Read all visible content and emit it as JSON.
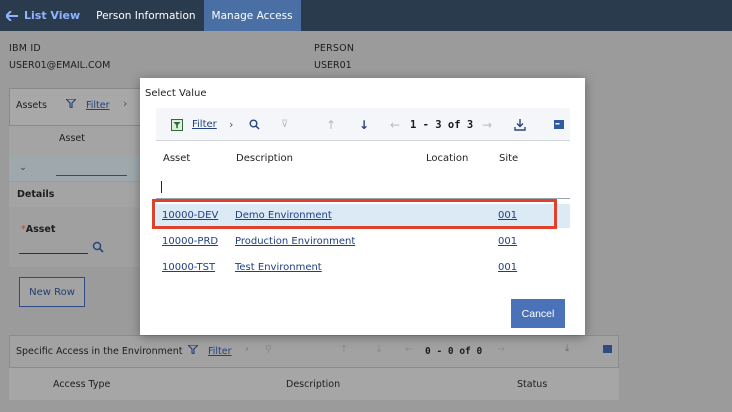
{
  "topbar": {
    "back_label": "List View",
    "tabs": [
      "Person Information",
      "Manage Access"
    ]
  },
  "person": {
    "ibm_id_label": "IBM ID",
    "ibm_id_value": "USER01@EMAIL.COM",
    "person_label": "PERSON",
    "person_value": "USER01"
  },
  "assets_section": {
    "tab_label": "Assets",
    "filter_label": "Filter",
    "column_asset": "Asset",
    "details_label": "Details",
    "asset_field_label": "Asset",
    "required_marker": "*",
    "new_row_label": "New Row"
  },
  "modal": {
    "title": "Select Value",
    "filter_label": "Filter",
    "pagination": "1 - 3 of 3",
    "columns": [
      "Asset",
      "Description",
      "Location",
      "Site"
    ],
    "rows": [
      {
        "asset": "10000-DEV",
        "description": "Demo Environment",
        "location": "",
        "site": "001",
        "selected": true
      },
      {
        "asset": "10000-PRD",
        "description": "Production Environment",
        "location": "",
        "site": "001",
        "selected": false
      },
      {
        "asset": "10000-TST",
        "description": "Test Environment",
        "location": "",
        "site": "001",
        "selected": false
      }
    ],
    "cancel_label": "Cancel"
  },
  "specific_access": {
    "title": "Specific Access in the Environment",
    "filter_label": "Filter",
    "pagination": "0 - 0 of 0",
    "columns": [
      "Access Type",
      "Description",
      "Status"
    ]
  },
  "colors": {
    "topbar": "#2b3b4e",
    "active_tab": "#4a6fa5",
    "highlight": "#e0412b",
    "primary_button": "#4a72b8",
    "selected_row": "#dbeaf5"
  }
}
